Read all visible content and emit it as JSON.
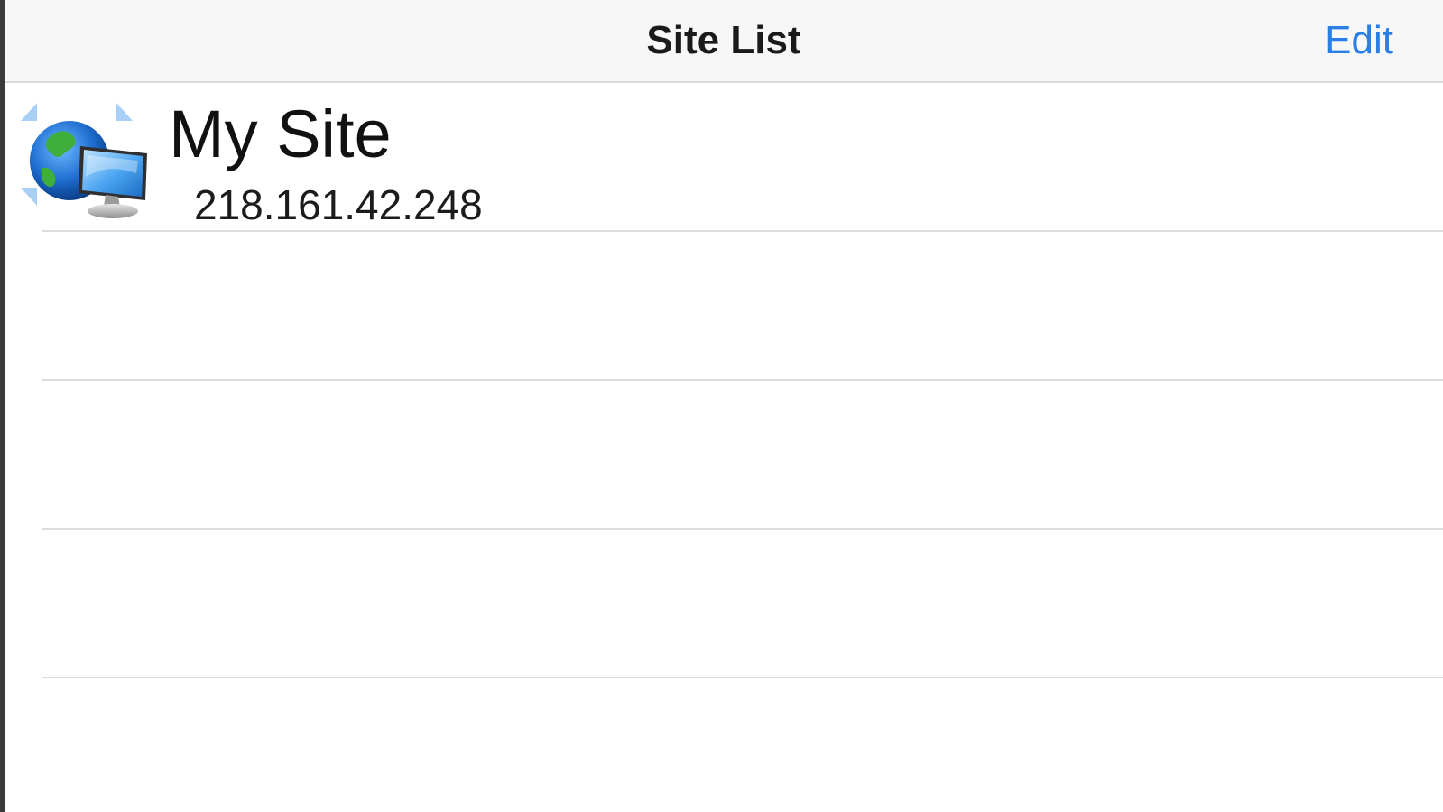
{
  "navbar": {
    "title": "Site List",
    "edit_label": "Edit"
  },
  "sites": [
    {
      "name": "My Site",
      "address": "218.161.42.248",
      "icon": "globe-monitor-icon"
    }
  ],
  "colors": {
    "accent": "#2a7fe6",
    "navbar_bg": "#f7f7f7",
    "separator": "#dcdcdc"
  }
}
